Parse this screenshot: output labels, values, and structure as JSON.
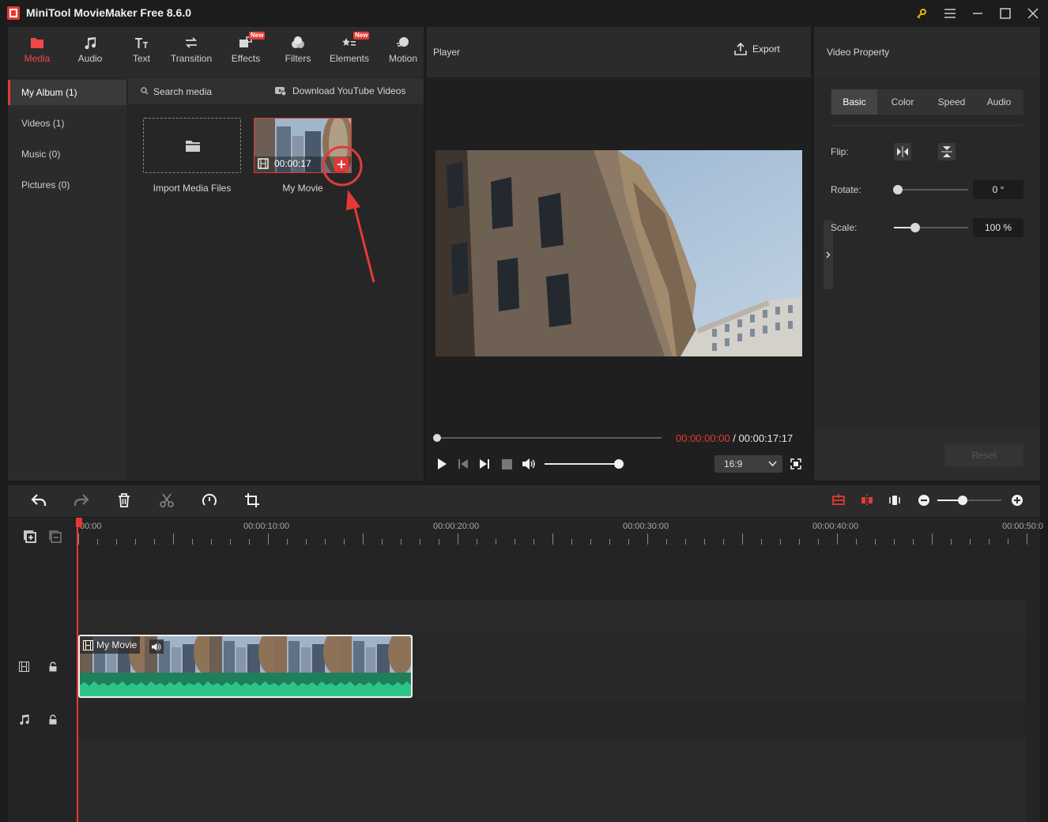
{
  "window": {
    "title": "MiniTool MovieMaker Free 8.6.0",
    "icons": [
      "key-icon",
      "menu-icon",
      "minimize-icon",
      "maximize-icon",
      "close-icon"
    ]
  },
  "toolbar": {
    "tabs": [
      {
        "label": "Media",
        "icon": "folder-icon",
        "active": true
      },
      {
        "label": "Audio",
        "icon": "music-note-icon"
      },
      {
        "label": "Text",
        "icon": "text-icon"
      },
      {
        "label": "Transition",
        "icon": "transition-arrows-icon"
      },
      {
        "label": "Effects",
        "icon": "effects-icon",
        "badge": "New"
      },
      {
        "label": "Filters",
        "icon": "filters-icon"
      },
      {
        "label": "Elements",
        "icon": "elements-icon",
        "badge": "New"
      },
      {
        "label": "Motion",
        "icon": "motion-icon"
      }
    ]
  },
  "album": {
    "items": [
      {
        "label": "My Album (1)",
        "active": true
      },
      {
        "label": "Videos (1)"
      },
      {
        "label": "Music (0)"
      },
      {
        "label": "Pictures (0)"
      }
    ]
  },
  "media": {
    "search_placeholder": "Search media",
    "download_label": "Download YouTube Videos",
    "import_label": "Import Media Files",
    "clip_duration": "00:00:17",
    "clip_name": "My Movie"
  },
  "player": {
    "title": "Player",
    "export_label": "Export",
    "current_time": "00:00:00:00",
    "separator": " / ",
    "total_time": "00:00:17:17",
    "aspect_ratio": "16:9",
    "progress": 0,
    "volume": 1.0
  },
  "property": {
    "title": "Video Property",
    "tabs": [
      "Basic",
      "Color",
      "Speed",
      "Audio"
    ],
    "active_tab": "Basic",
    "flip_label": "Flip:",
    "rotate_label": "Rotate:",
    "rotate_value": "0 °",
    "rotate_level": 0,
    "scale_label": "Scale:",
    "scale_value": "100 %",
    "scale_level": 0.29,
    "reset_label": "Reset"
  },
  "timeline": {
    "times": [
      "00:00",
      "00:00:10:00",
      "00:00:20:00",
      "00:00:30:00",
      "00:00:40:00",
      "00:00:50:0"
    ],
    "clip_label": "My Movie",
    "zoom_level": 0.4
  },
  "colors": {
    "accent": "#e53935",
    "waveform": "#1fae74",
    "panel": "#2b2b2b"
  }
}
